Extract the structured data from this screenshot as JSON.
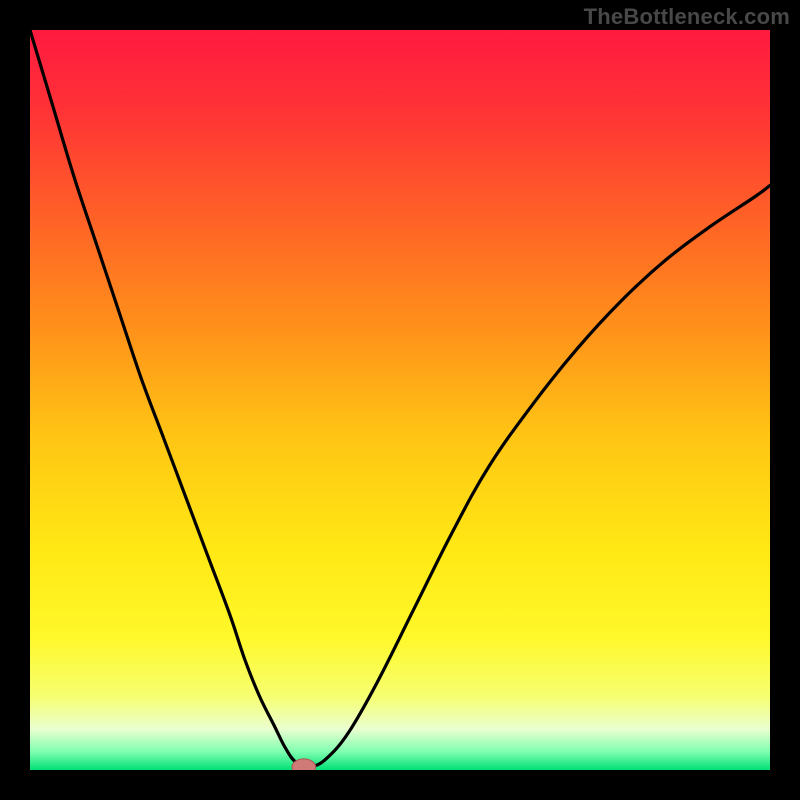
{
  "watermark": "TheBottleneck.com",
  "colors": {
    "bg_frame": "#000000",
    "curve": "#000000",
    "marker_fill": "#cf7a76",
    "marker_stroke": "#a85a56",
    "gradient_stops": [
      {
        "offset": 0.0,
        "color": "#ff1a40"
      },
      {
        "offset": 0.1,
        "color": "#ff3037"
      },
      {
        "offset": 0.25,
        "color": "#ff6027"
      },
      {
        "offset": 0.4,
        "color": "#ff901a"
      },
      {
        "offset": 0.55,
        "color": "#ffc514"
      },
      {
        "offset": 0.7,
        "color": "#ffe814"
      },
      {
        "offset": 0.82,
        "color": "#fff82a"
      },
      {
        "offset": 0.9,
        "color": "#f6ff70"
      },
      {
        "offset": 0.945,
        "color": "#eaffd0"
      },
      {
        "offset": 0.975,
        "color": "#80ffb0"
      },
      {
        "offset": 1.0,
        "color": "#00e076"
      }
    ]
  },
  "chart_data": {
    "type": "line",
    "title": "",
    "xlabel": "",
    "ylabel": "",
    "xlim": [
      0,
      100
    ],
    "ylim": [
      0,
      100
    ],
    "grid": false,
    "legend": false,
    "series": [
      {
        "name": "bottleneck-curve",
        "x": [
          0,
          3,
          6,
          9,
          12,
          15,
          18,
          21,
          24,
          27,
          29,
          31,
          33,
          34.5,
          36,
          38,
          40,
          43,
          47,
          52,
          57,
          62,
          68,
          74,
          80,
          86,
          92,
          98,
          100
        ],
        "y": [
          100,
          90,
          80,
          71,
          62,
          53,
          45,
          37,
          29,
          21,
          15,
          10,
          6,
          3,
          1,
          0.5,
          1.5,
          5,
          12,
          22,
          32,
          41,
          49.5,
          57,
          63.5,
          69,
          73.5,
          77.5,
          79
        ]
      }
    ],
    "marker": {
      "x": 37,
      "y": 0.4,
      "rx": 1.6,
      "ry": 1.1
    }
  }
}
